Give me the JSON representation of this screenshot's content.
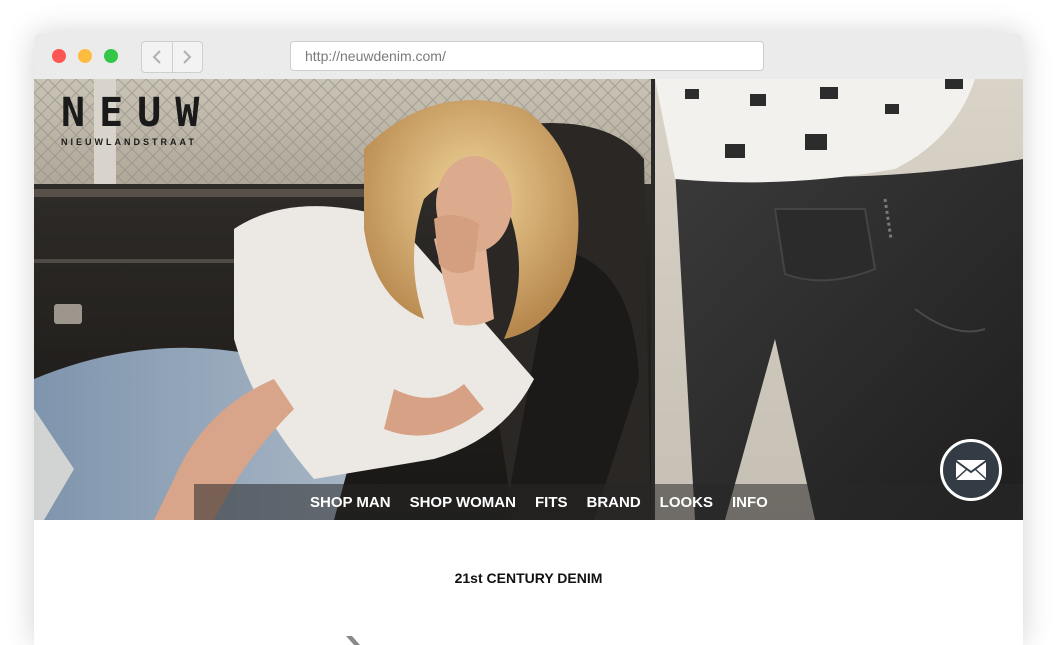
{
  "browser": {
    "url": "http://neuwdenim.com/",
    "back_icon": "chevron-left-icon",
    "forward_icon": "chevron-right-icon"
  },
  "brand": {
    "name": "NEUW",
    "subtitle": "NIEUWLANDSTRAAT"
  },
  "nav": {
    "items": [
      {
        "label": "SHOP MAN"
      },
      {
        "label": "SHOP WOMAN"
      },
      {
        "label": "FITS"
      },
      {
        "label": "BRAND"
      },
      {
        "label": "LOOKS"
      },
      {
        "label": "INFO"
      }
    ]
  },
  "contact": {
    "icon": "envelope-icon"
  },
  "main": {
    "heading": "21st CENTURY DENIM"
  },
  "colors": {
    "close": "#fc5753",
    "minimize": "#fdbc40",
    "maximize": "#33c748",
    "mail_button": "#333c45"
  }
}
